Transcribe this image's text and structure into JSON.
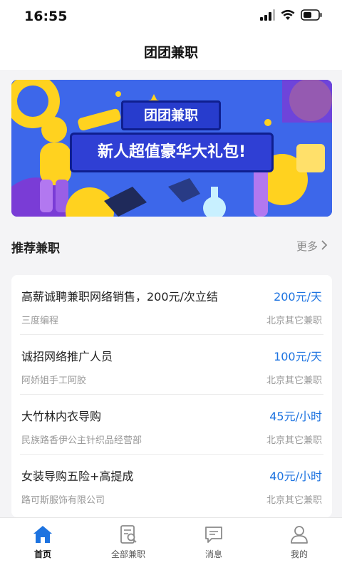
{
  "status": {
    "time": "16:55"
  },
  "nav": {
    "title": "团团兼职"
  },
  "banner": {
    "tag": "团团兼职",
    "headline": "新人超值豪华大礼包!"
  },
  "section": {
    "title": "推荐兼职",
    "more": "更多"
  },
  "jobs": [
    {
      "title": "高薪诚聘兼职网络销售，200元/次立结",
      "salary": "200元/天",
      "company": "三度编程",
      "location": "北京其它兼职"
    },
    {
      "title": "诚招网络推广人员",
      "salary": "100元/天",
      "company": "阿娇姐手工阿胶",
      "location": "北京其它兼职"
    },
    {
      "title": "大竹林内衣导购",
      "salary": "45元/小时",
      "company": "民族路香伊公主针织品经营部",
      "location": "北京其它兼职"
    },
    {
      "title": "女装导购五险+高提成",
      "salary": "40元/小时",
      "company": "路可斯服饰有限公司",
      "location": "北京其它兼职"
    }
  ],
  "tabs": [
    {
      "label": "首页",
      "icon": "home-icon"
    },
    {
      "label": "全部兼职",
      "icon": "document-search-icon"
    },
    {
      "label": "消息",
      "icon": "message-icon"
    },
    {
      "label": "我的",
      "icon": "user-icon"
    }
  ],
  "colors": {
    "accent": "#1d73e0",
    "banner_bg": "#3d67ea"
  }
}
